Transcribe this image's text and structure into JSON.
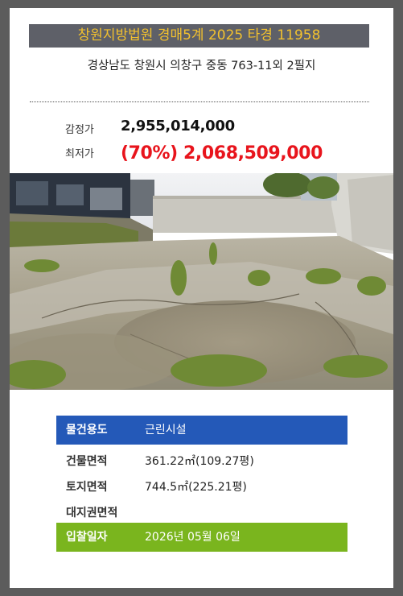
{
  "header": {
    "court_case": "창원지방법원 경매5계 2025 타경 11958",
    "address": "경상남도 창원시 의창구 중동 763-11외 2필지"
  },
  "prices": {
    "appraisal_label": "감정가",
    "appraisal_value": "2,955,014,000",
    "minimum_label": "최저가",
    "minimum_value": "(70%) 2,068,509,000"
  },
  "property": {
    "usage_label": "물건용도",
    "usage_value": "근린시설",
    "building_area_label": "건물면적",
    "building_area_value": "361.22㎡(109.27평)",
    "land_area_label": "토지면적",
    "land_area_value": "744.5㎡(225.21평)",
    "land_right_label": "대지권면적",
    "land_right_value": "",
    "bid_date_label": "입찰일자",
    "bid_date_value": "2026년 05월 06일"
  },
  "colors": {
    "court_bar_bg": "#5e6068",
    "court_bar_text": "#f2c12e",
    "minimum_price": "#e8141c",
    "usage_bar": "#2459b8",
    "bid_date_bar": "#7ab51e"
  }
}
